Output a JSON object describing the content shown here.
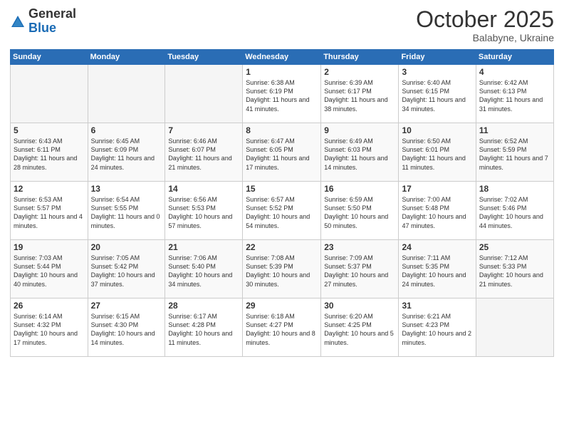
{
  "logo": {
    "general": "General",
    "blue": "Blue"
  },
  "title": "October 2025",
  "subtitle": "Balabyne, Ukraine",
  "days_of_week": [
    "Sunday",
    "Monday",
    "Tuesday",
    "Wednesday",
    "Thursday",
    "Friday",
    "Saturday"
  ],
  "weeks": [
    [
      {
        "day": "",
        "content": ""
      },
      {
        "day": "",
        "content": ""
      },
      {
        "day": "",
        "content": ""
      },
      {
        "day": "1",
        "content": "Sunrise: 6:38 AM\nSunset: 6:19 PM\nDaylight: 11 hours\nand 41 minutes."
      },
      {
        "day": "2",
        "content": "Sunrise: 6:39 AM\nSunset: 6:17 PM\nDaylight: 11 hours\nand 38 minutes."
      },
      {
        "day": "3",
        "content": "Sunrise: 6:40 AM\nSunset: 6:15 PM\nDaylight: 11 hours\nand 34 minutes."
      },
      {
        "day": "4",
        "content": "Sunrise: 6:42 AM\nSunset: 6:13 PM\nDaylight: 11 hours\nand 31 minutes."
      }
    ],
    [
      {
        "day": "5",
        "content": "Sunrise: 6:43 AM\nSunset: 6:11 PM\nDaylight: 11 hours\nand 28 minutes."
      },
      {
        "day": "6",
        "content": "Sunrise: 6:45 AM\nSunset: 6:09 PM\nDaylight: 11 hours\nand 24 minutes."
      },
      {
        "day": "7",
        "content": "Sunrise: 6:46 AM\nSunset: 6:07 PM\nDaylight: 11 hours\nand 21 minutes."
      },
      {
        "day": "8",
        "content": "Sunrise: 6:47 AM\nSunset: 6:05 PM\nDaylight: 11 hours\nand 17 minutes."
      },
      {
        "day": "9",
        "content": "Sunrise: 6:49 AM\nSunset: 6:03 PM\nDaylight: 11 hours\nand 14 minutes."
      },
      {
        "day": "10",
        "content": "Sunrise: 6:50 AM\nSunset: 6:01 PM\nDaylight: 11 hours\nand 11 minutes."
      },
      {
        "day": "11",
        "content": "Sunrise: 6:52 AM\nSunset: 5:59 PM\nDaylight: 11 hours\nand 7 minutes."
      }
    ],
    [
      {
        "day": "12",
        "content": "Sunrise: 6:53 AM\nSunset: 5:57 PM\nDaylight: 11 hours\nand 4 minutes."
      },
      {
        "day": "13",
        "content": "Sunrise: 6:54 AM\nSunset: 5:55 PM\nDaylight: 11 hours\nand 0 minutes."
      },
      {
        "day": "14",
        "content": "Sunrise: 6:56 AM\nSunset: 5:53 PM\nDaylight: 10 hours\nand 57 minutes."
      },
      {
        "day": "15",
        "content": "Sunrise: 6:57 AM\nSunset: 5:52 PM\nDaylight: 10 hours\nand 54 minutes."
      },
      {
        "day": "16",
        "content": "Sunrise: 6:59 AM\nSunset: 5:50 PM\nDaylight: 10 hours\nand 50 minutes."
      },
      {
        "day": "17",
        "content": "Sunrise: 7:00 AM\nSunset: 5:48 PM\nDaylight: 10 hours\nand 47 minutes."
      },
      {
        "day": "18",
        "content": "Sunrise: 7:02 AM\nSunset: 5:46 PM\nDaylight: 10 hours\nand 44 minutes."
      }
    ],
    [
      {
        "day": "19",
        "content": "Sunrise: 7:03 AM\nSunset: 5:44 PM\nDaylight: 10 hours\nand 40 minutes."
      },
      {
        "day": "20",
        "content": "Sunrise: 7:05 AM\nSunset: 5:42 PM\nDaylight: 10 hours\nand 37 minutes."
      },
      {
        "day": "21",
        "content": "Sunrise: 7:06 AM\nSunset: 5:40 PM\nDaylight: 10 hours\nand 34 minutes."
      },
      {
        "day": "22",
        "content": "Sunrise: 7:08 AM\nSunset: 5:39 PM\nDaylight: 10 hours\nand 30 minutes."
      },
      {
        "day": "23",
        "content": "Sunrise: 7:09 AM\nSunset: 5:37 PM\nDaylight: 10 hours\nand 27 minutes."
      },
      {
        "day": "24",
        "content": "Sunrise: 7:11 AM\nSunset: 5:35 PM\nDaylight: 10 hours\nand 24 minutes."
      },
      {
        "day": "25",
        "content": "Sunrise: 7:12 AM\nSunset: 5:33 PM\nDaylight: 10 hours\nand 21 minutes."
      }
    ],
    [
      {
        "day": "26",
        "content": "Sunrise: 6:14 AM\nSunset: 4:32 PM\nDaylight: 10 hours\nand 17 minutes."
      },
      {
        "day": "27",
        "content": "Sunrise: 6:15 AM\nSunset: 4:30 PM\nDaylight: 10 hours\nand 14 minutes."
      },
      {
        "day": "28",
        "content": "Sunrise: 6:17 AM\nSunset: 4:28 PM\nDaylight: 10 hours\nand 11 minutes."
      },
      {
        "day": "29",
        "content": "Sunrise: 6:18 AM\nSunset: 4:27 PM\nDaylight: 10 hours\nand 8 minutes."
      },
      {
        "day": "30",
        "content": "Sunrise: 6:20 AM\nSunset: 4:25 PM\nDaylight: 10 hours\nand 5 minutes."
      },
      {
        "day": "31",
        "content": "Sunrise: 6:21 AM\nSunset: 4:23 PM\nDaylight: 10 hours\nand 2 minutes."
      },
      {
        "day": "",
        "content": ""
      }
    ]
  ]
}
